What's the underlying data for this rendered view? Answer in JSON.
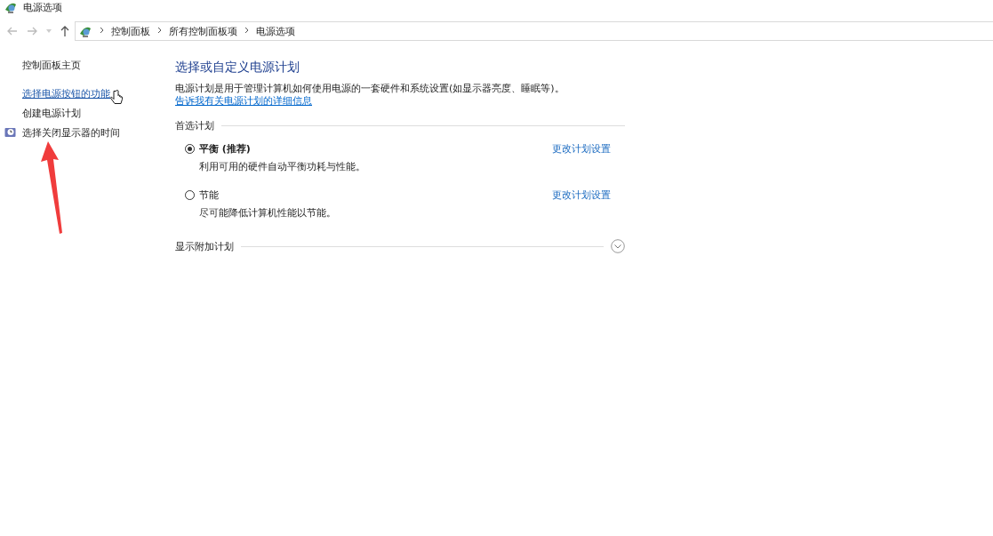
{
  "window": {
    "title": "电源选项"
  },
  "breadcrumb": [
    "控制面板",
    "所有控制面板项",
    "电源选项"
  ],
  "sidebar": {
    "items": [
      {
        "label": "控制面板主页",
        "kind": "plain"
      },
      {
        "label": "选择电源按钮的功能",
        "kind": "link"
      },
      {
        "label": "创建电源计划",
        "kind": "plain"
      },
      {
        "label": "选择关闭显示器的时间",
        "kind": "icon"
      }
    ]
  },
  "main": {
    "heading": "选择或自定义电源计划",
    "description": "电源计划是用于管理计算机如何使用电源的一套硬件和系统设置(如显示器亮度、睡眠等)。",
    "info_link": "告诉我有关电源计划的详细信息",
    "preferred_section": "首选计划",
    "plans": [
      {
        "name": "平衡 (推荐)",
        "description": "利用可用的硬件自动平衡功耗与性能。",
        "selected": true,
        "link": "更改计划设置"
      },
      {
        "name": "节能",
        "description": "尽可能降低计算机性能以节能。",
        "selected": false,
        "link": "更改计划设置"
      }
    ],
    "more_section": "显示附加计划",
    "more_expanded": false
  }
}
